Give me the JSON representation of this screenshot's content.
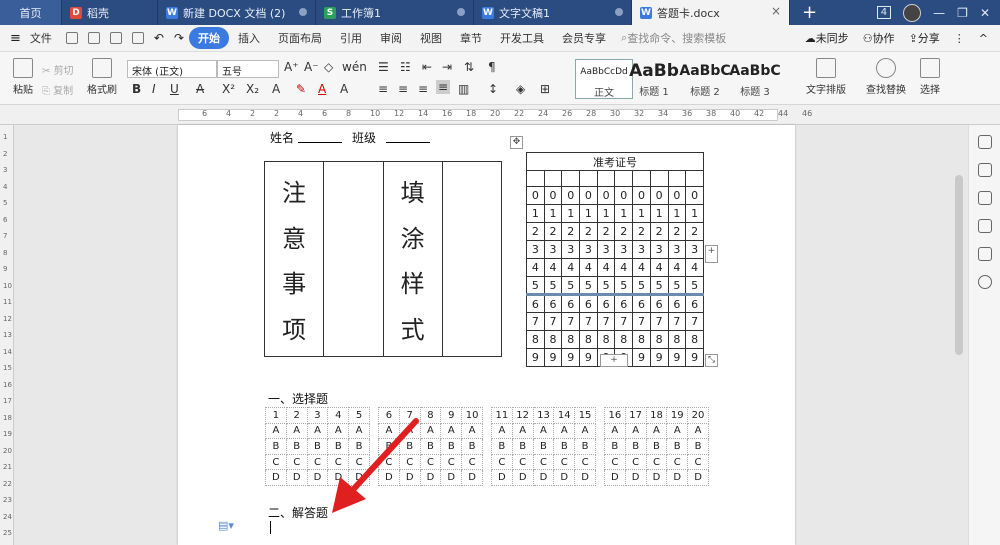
{
  "tabs": {
    "home": "首页",
    "t1": "稻壳",
    "t2": "新建 DOCX 文档 (2)",
    "t3": "工作簿1",
    "t4": "文字文稿1",
    "t5": "答题卡.docx",
    "badge": "4"
  },
  "menu": {
    "file": "文件",
    "items": [
      "开始",
      "插入",
      "页面布局",
      "引用",
      "审阅",
      "视图",
      "章节",
      "开发工具",
      "会员专享"
    ],
    "search_placeholder": "查找命令、搜索模板",
    "sync": "未同步",
    "collab": "协作",
    "share": "分享"
  },
  "ribbon": {
    "paste": "粘贴",
    "cut": "剪切",
    "copy": "复制",
    "format_painter": "格式刷",
    "font_name": "宋体 (正文)",
    "font_size": "五号",
    "styles": [
      {
        "sample": "AaBbCcDd",
        "name": "正文"
      },
      {
        "sample": "AaBb",
        "name": "标题 1"
      },
      {
        "sample": "AaBbC",
        "name": "标题 2"
      },
      {
        "sample": "AaBbC",
        "name": "标题 3"
      }
    ],
    "text_layout": "文字排版",
    "find_replace": "查找替换",
    "select": "选择"
  },
  "ruler": {
    "h_numbers": [
      "6",
      "4",
      "2",
      "2",
      "4",
      "6",
      "8",
      "10",
      "12",
      "14",
      "16",
      "18",
      "20",
      "22",
      "24",
      "26",
      "28",
      "30",
      "32",
      "34",
      "36",
      "38",
      "40",
      "42",
      "44",
      "46"
    ],
    "v_numbers": [
      "1",
      "2",
      "3",
      "4",
      "5",
      "6",
      "7",
      "8",
      "9",
      "10",
      "11",
      "12",
      "13",
      "14",
      "15",
      "16",
      "17",
      "18",
      "19",
      "20",
      "21",
      "22",
      "23",
      "24",
      "25"
    ]
  },
  "doc": {
    "name_label": "姓名",
    "class_label": "班级",
    "notes_chars": [
      "注",
      "意",
      "事",
      "项"
    ],
    "sample_chars": [
      "填",
      "涂",
      "样",
      "式"
    ],
    "admit_title": "准考证号",
    "digits": [
      "0",
      "1",
      "2",
      "3",
      "4",
      "5",
      "6",
      "7",
      "8",
      "9"
    ],
    "section1": "一、选择题",
    "choice_groups": [
      [
        "1",
        "2",
        "3",
        "4",
        "5"
      ],
      [
        "6",
        "7",
        "8",
        "9",
        "10"
      ],
      [
        "11",
        "12",
        "13",
        "14",
        "15"
      ],
      [
        "16",
        "17",
        "18",
        "19",
        "20"
      ]
    ],
    "options": [
      "A",
      "B",
      "C",
      "D"
    ],
    "section2": "二、解答题"
  }
}
